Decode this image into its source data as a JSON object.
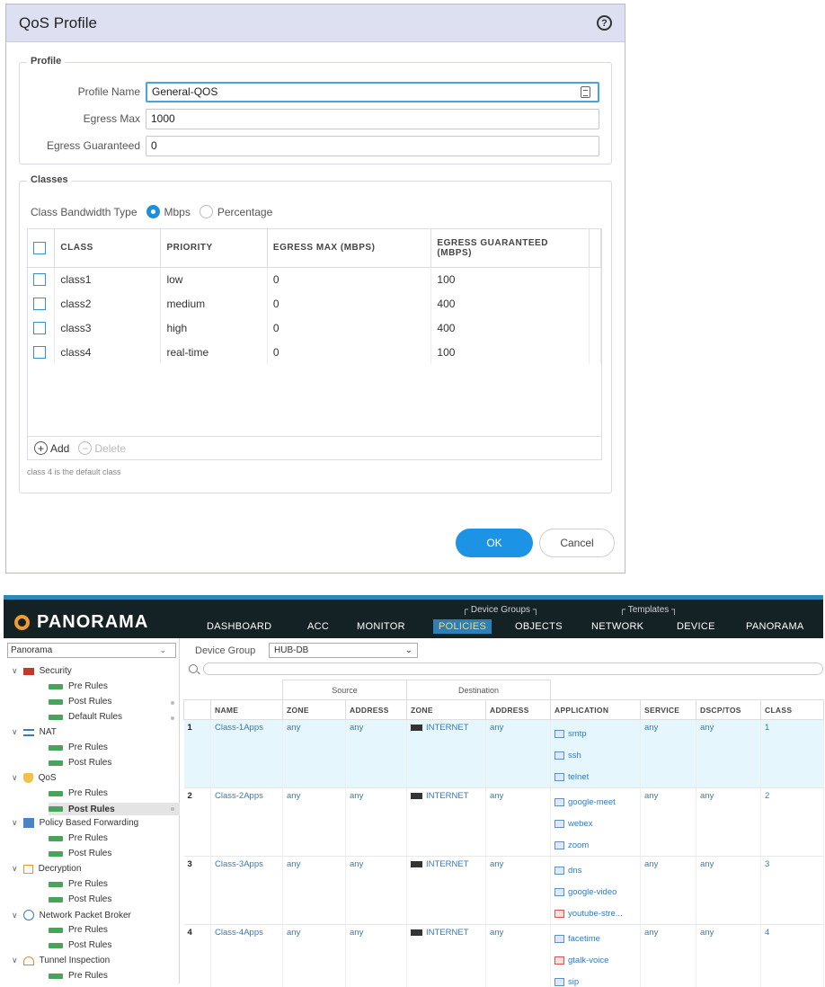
{
  "qos_dialog": {
    "title": "QoS Profile",
    "profile": {
      "legend": "Profile",
      "name_label": "Profile Name",
      "name_value": "General-QOS",
      "egress_max_label": "Egress Max",
      "egress_max_value": "1000",
      "egress_guaranteed_label": "Egress Guaranteed",
      "egress_guaranteed_value": "0"
    },
    "classes": {
      "legend": "Classes",
      "bandwidth_label": "Class Bandwidth Type",
      "option_mbps": "Mbps",
      "option_percentage": "Percentage",
      "selected": "Mbps",
      "columns": [
        "CLASS",
        "PRIORITY",
        "EGRESS MAX (MBPS)",
        "EGRESS GUARANTEED (MBPS)"
      ],
      "rows": [
        {
          "class": "class1",
          "priority": "low",
          "egress_max": "0",
          "egress_guaranteed": "100"
        },
        {
          "class": "class2",
          "priority": "medium",
          "egress_max": "0",
          "egress_guaranteed": "400"
        },
        {
          "class": "class3",
          "priority": "high",
          "egress_max": "0",
          "egress_guaranteed": "400"
        },
        {
          "class": "class4",
          "priority": "real-time",
          "egress_max": "0",
          "egress_guaranteed": "100"
        }
      ],
      "add_label": "Add",
      "delete_label": "Delete",
      "note": "class 4 is the default class"
    },
    "ok_label": "OK",
    "cancel_label": "Cancel"
  },
  "panorama": {
    "logo": "PANORAMA",
    "nav": {
      "dashboard": "DASHBOARD",
      "acc": "ACC",
      "monitor": "MONITOR",
      "policies": "POLICIES",
      "objects": "OBJECTS",
      "network": "NETWORK",
      "device": "DEVICE",
      "panorama": "PANORAMA",
      "group_device_groups": "Device Groups",
      "group_templates": "Templates",
      "active": "POLICIES"
    },
    "context_select": "Panorama",
    "device_group_label": "Device Group",
    "device_group_value": "HUB-DB",
    "tree": {
      "security": "Security",
      "nat": "NAT",
      "qos": "QoS",
      "pbf": "Policy Based Forwarding",
      "decryption": "Decryption",
      "npb": "Network Packet Broker",
      "tunnel": "Tunnel Inspection",
      "pre_rules": "Pre Rules",
      "post_rules": "Post Rules",
      "default_rules": "Default Rules"
    },
    "table": {
      "group_source": "Source",
      "group_destination": "Destination",
      "columns": [
        "NAME",
        "ZONE",
        "ADDRESS",
        "ZONE",
        "ADDRESS",
        "APPLICATION",
        "SERVICE",
        "DSCP/TOS",
        "CLASS"
      ],
      "rows": [
        {
          "num": "1",
          "name": "Class-1Apps",
          "src_zone": "any",
          "src_addr": "any",
          "dst_zone": "INTERNET",
          "dst_addr": "any",
          "apps": [
            "smtp",
            "ssh",
            "telnet"
          ],
          "service": "any",
          "dscp": "any",
          "class": "1"
        },
        {
          "num": "2",
          "name": "Class-2Apps",
          "src_zone": "any",
          "src_addr": "any",
          "dst_zone": "INTERNET",
          "dst_addr": "any",
          "apps": [
            "google-meet",
            "webex",
            "zoom"
          ],
          "service": "any",
          "dscp": "any",
          "class": "2"
        },
        {
          "num": "3",
          "name": "Class-3Apps",
          "src_zone": "any",
          "src_addr": "any",
          "dst_zone": "INTERNET",
          "dst_addr": "any",
          "apps": [
            "dns",
            "google-video",
            "youtube-stre..."
          ],
          "service": "any",
          "dscp": "any",
          "class": "3"
        },
        {
          "num": "4",
          "name": "Class-4Apps",
          "src_zone": "any",
          "src_addr": "any",
          "dst_zone": "INTERNET",
          "dst_addr": "any",
          "apps": [
            "facetime",
            "gtalk-voice",
            "sip"
          ],
          "service": "any",
          "dscp": "any",
          "class": "4"
        }
      ]
    }
  },
  "colors": {
    "dialog_header": "#dde0f0",
    "ok_button": "#1c93e4",
    "nav_bar": "#152225",
    "nav_active": "#2d7fb5",
    "link_blue": "#3579b8",
    "logo_orange": "#f29b30"
  },
  "icons": [
    "help-icon",
    "list-icon",
    "add-icon",
    "delete-icon",
    "search-icon",
    "chevron-down-icon",
    "zone-icon",
    "app-icon"
  ]
}
